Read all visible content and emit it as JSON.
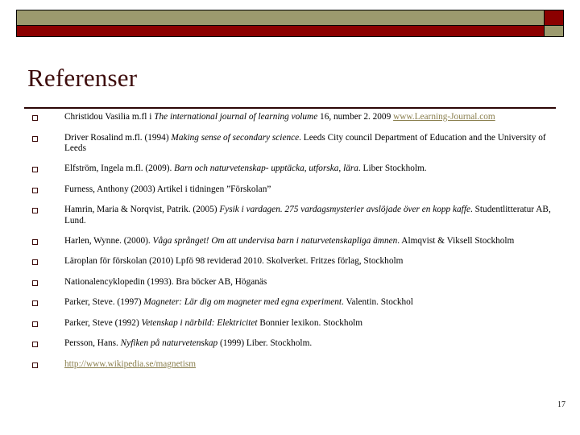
{
  "slide": {
    "title": "Referenser",
    "page_number": "17",
    "colors": {
      "title": "#3d0c0c",
      "deco_olive": "#9c9a6e",
      "deco_red": "#8b0000",
      "link": "#8a7f4e"
    }
  },
  "references": [
    {
      "id": "ref-christidou",
      "parts": [
        {
          "type": "text",
          "value": "Christidou Vasilia m.fl  i "
        },
        {
          "type": "italic",
          "value": "The international journal of learning volume"
        },
        {
          "type": "text",
          "value": " 16, number 2. 2009 "
        },
        {
          "type": "link",
          "value": "www.Learning-Journal.com"
        }
      ]
    },
    {
      "id": "ref-driver",
      "parts": [
        {
          "type": "text",
          "value": "Driver Rosalind m.fl. (1994) "
        },
        {
          "type": "italic",
          "value": "Making sense of secondary science"
        },
        {
          "type": "text",
          "value": ". Leeds City council Department of Education and the University of Leeds"
        }
      ]
    },
    {
      "id": "ref-elfstrom",
      "parts": [
        {
          "type": "text",
          "value": "Elfström, Ingela m.fl. (2009). "
        },
        {
          "type": "italic",
          "value": "Barn och naturvetenskap- upptäcka, utforska, lära"
        },
        {
          "type": "text",
          "value": ". Liber Stockholm."
        }
      ]
    },
    {
      "id": "ref-furness",
      "parts": [
        {
          "type": "text",
          "value": "Furness, Anthony (2003) Artikel i tidningen ”Förskolan”"
        }
      ]
    },
    {
      "id": "ref-hamrin",
      "parts": [
        {
          "type": "text",
          "value": "Hamrin, Maria & Norqvist, Patrik. (2005) "
        },
        {
          "type": "italic",
          "value": "Fysik i vardagen. 275 vardagsmysterier avslöjade över en kopp kaffe"
        },
        {
          "type": "text",
          "value": ". Studentlitteratur AB, Lund."
        }
      ]
    },
    {
      "id": "ref-harlen",
      "parts": [
        {
          "type": "text",
          "value": "Harlen, Wynne. (2000). "
        },
        {
          "type": "italic",
          "value": "Våga språnget! Om att undervisa barn i naturvetenskapliga ämnen"
        },
        {
          "type": "text",
          "value": ". Almqvist & Viksell Stockholm"
        }
      ]
    },
    {
      "id": "ref-laroplan",
      "parts": [
        {
          "type": "text",
          "value": "Läroplan för förskolan (2010) Lpfö 98 reviderad 2010. Skolverket. Fritzes förlag, Stockholm"
        }
      ]
    },
    {
      "id": "ref-nationalencyklopedin",
      "parts": [
        {
          "type": "text",
          "value": "Nationalencyklopedin (1993). Bra böcker AB, Höganäs"
        }
      ]
    },
    {
      "id": "ref-parker-1997",
      "parts": [
        {
          "type": "text",
          "value": "Parker, Steve. (1997) "
        },
        {
          "type": "italic",
          "value": "Magneter: Lär dig om magneter med egna experiment"
        },
        {
          "type": "text",
          "value": ". Valentin. Stockhol"
        }
      ]
    },
    {
      "id": "ref-parker-1992",
      "parts": [
        {
          "type": "text",
          "value": "Parker, Steve (1992) "
        },
        {
          "type": "italic",
          "value": "Vetenskap i närbild: Elektricitet"
        },
        {
          "type": "text",
          "value": " Bonnier lexikon. Stockholm"
        }
      ]
    },
    {
      "id": "ref-persson",
      "parts": [
        {
          "type": "text",
          "value": "Persson, Hans. "
        },
        {
          "type": "italic",
          "value": "Nyfiken på naturvetenskap"
        },
        {
          "type": "text",
          "value": " (1999) Liber. Stockholm."
        }
      ]
    },
    {
      "id": "ref-wikipedia",
      "parts": [
        {
          "type": "link",
          "value": "http://www.wikipedia.se/magnetism"
        }
      ]
    }
  ]
}
